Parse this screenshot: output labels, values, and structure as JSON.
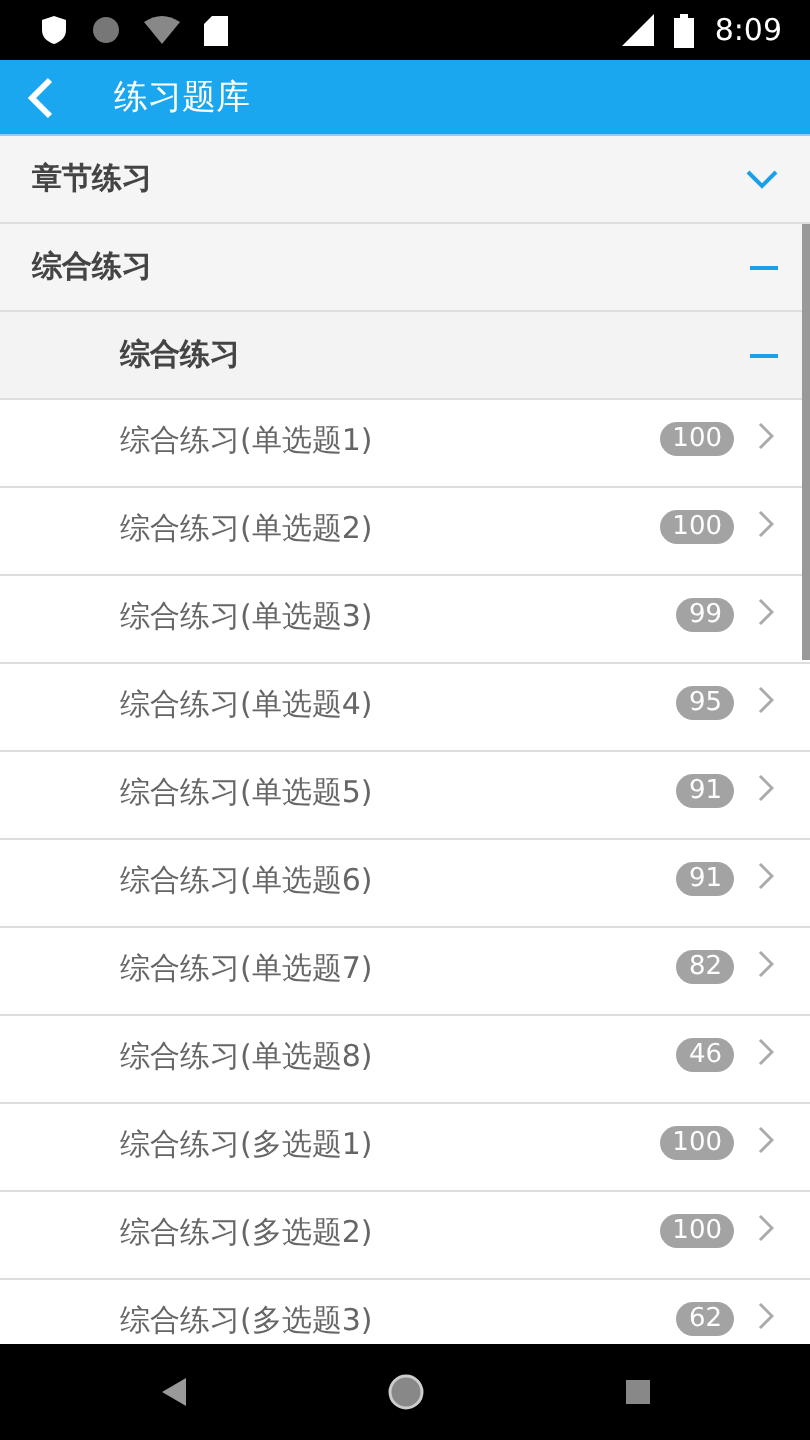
{
  "status_bar": {
    "time": "8:09"
  },
  "app_bar": {
    "title": "练习题库"
  },
  "sections": [
    {
      "title": "章节练习",
      "expanded": false
    },
    {
      "title": "综合练习",
      "expanded": true,
      "groups": [
        {
          "title": "综合练习",
          "expanded": true,
          "items": [
            {
              "label": "综合练习(单选题1)",
              "count": "100"
            },
            {
              "label": "综合练习(单选题2)",
              "count": "100"
            },
            {
              "label": "综合练习(单选题3)",
              "count": "99"
            },
            {
              "label": "综合练习(单选题4)",
              "count": "95"
            },
            {
              "label": "综合练习(单选题5)",
              "count": "91"
            },
            {
              "label": "综合练习(单选题6)",
              "count": "91"
            },
            {
              "label": "综合练习(单选题7)",
              "count": "82"
            },
            {
              "label": "综合练习(单选题8)",
              "count": "46"
            },
            {
              "label": "综合练习(多选题1)",
              "count": "100"
            },
            {
              "label": "综合练习(多选题2)",
              "count": "100"
            },
            {
              "label": "综合练习(多选题3)",
              "count": "62"
            }
          ]
        }
      ]
    }
  ]
}
